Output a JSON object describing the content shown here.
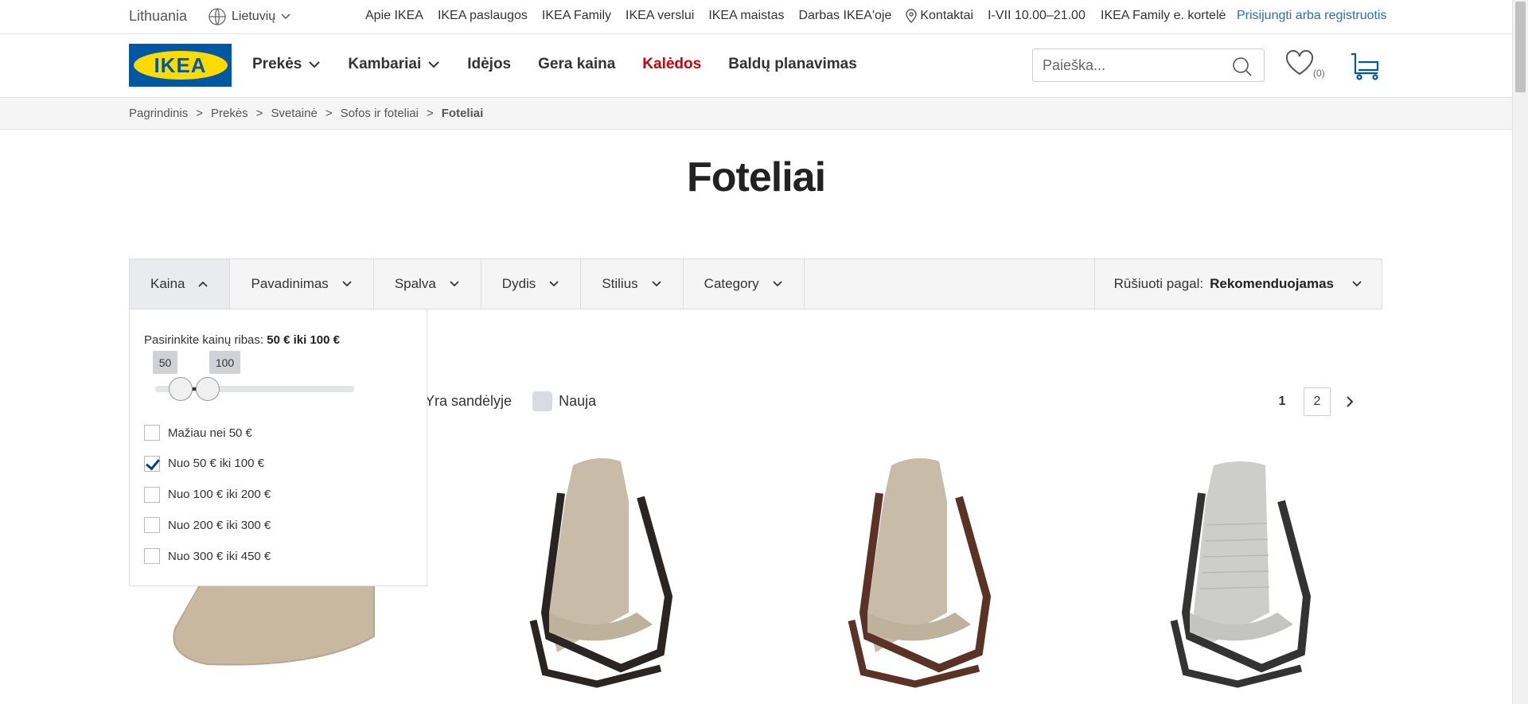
{
  "topbar": {
    "country": "Lithuania",
    "language": "Lietuvių",
    "links": [
      "Apie IKEA",
      "IKEA paslaugos",
      "IKEA Family",
      "IKEA verslui",
      "IKEA maistas",
      "Darbas IKEA'oje"
    ],
    "contact": "Kontaktai",
    "hours": "I-VII 10.00–21.00",
    "family_card": "IKEA Family e. kortelė",
    "login": "Prisijungti arba registruotis"
  },
  "header": {
    "logo_text": "IKEA",
    "nav": [
      "Prekės",
      "Kambariai",
      "Idėjos",
      "Gera kaina",
      "Kalėdos",
      "Baldų planavimas"
    ],
    "search_placeholder": "Paieška...",
    "wishlist_count": "(0)"
  },
  "breadcrumb": [
    "Pagrindinis",
    "Prekės",
    "Svetainė",
    "Sofos ir foteliai",
    "Foteliai"
  ],
  "page": {
    "title": "Foteliai"
  },
  "filters": {
    "items": [
      "Kaina",
      "Pavadinimas",
      "Spalva",
      "Dydis",
      "Stilius",
      "Category"
    ],
    "sort_label": "Rūšiuoti pagal:",
    "sort_value": "Rekomenduojamas"
  },
  "price_filter": {
    "range_label": "Pasirinkite kainų ribas:",
    "range_value": "50 € iki 100 €",
    "min_tip": "50",
    "max_tip": "100",
    "options": [
      {
        "label": "Mažiau nei 50 €",
        "checked": false
      },
      {
        "label": "Nuo 50 € iki 100 €",
        "checked": true
      },
      {
        "label": "Nuo 100 € iki 200 €",
        "checked": false
      },
      {
        "label": "Nuo 200 € iki 300 €",
        "checked": false
      },
      {
        "label": "Nuo 300 € iki 450 €",
        "checked": false
      }
    ]
  },
  "toggles": {
    "in_stock": "Yra sandėlyje",
    "new": "Nauja"
  },
  "pagination": {
    "current": "1",
    "next_page": "2"
  },
  "colors": {
    "ikea_blue": "#0058a3",
    "ikea_yellow": "#ffdb00",
    "christmas_red": "#cc0008",
    "link_blue": "#2a6ebb"
  }
}
